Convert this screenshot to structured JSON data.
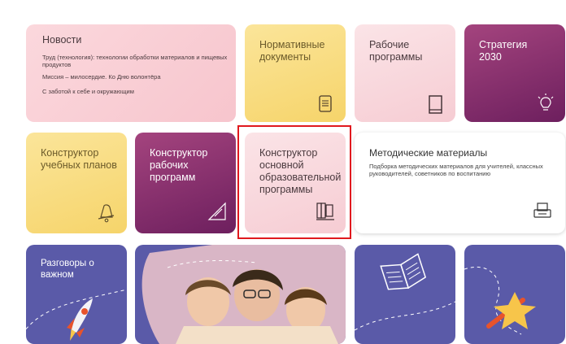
{
  "news": {
    "title": "Новости",
    "items": [
      "Труд (технология): технологии обработки материалов и пищевых продуктов",
      "Миссия – милосердие. Ко Дню волонтёра",
      "С заботой к себе и окружающим"
    ]
  },
  "tiles": {
    "normative": "Нормативные документы",
    "work_programs": "Рабочие программы",
    "strategy": "Стратегия 2030",
    "curriculum_builder": "Конструктор учебных планов",
    "work_program_builder": "Конструктор рабочих программ",
    "main_program_builder": "Конструктор основной образовательной программы",
    "methodical": {
      "title": "Методические материалы",
      "description": "Подборка методических материалов для учителей, классных руководителей, советников по воспитанию"
    },
    "important_talks": "Разговоры о важном"
  },
  "colors": {
    "yellow": "#f6d46a",
    "pink": "#f6ccd3",
    "purple": "#8a2c6e",
    "indigo": "#5a5aa8",
    "selection": "#e0191e"
  },
  "icons": {
    "normative": "document-icon",
    "work_programs": "book-icon",
    "strategy": "lightbulb-icon",
    "curriculum_builder": "bell-icon",
    "work_program_builder": "ruler-pencil-icon",
    "main_program_builder": "books-icon",
    "methodical": "printer-icon",
    "important_talks": "rocket-icon"
  }
}
